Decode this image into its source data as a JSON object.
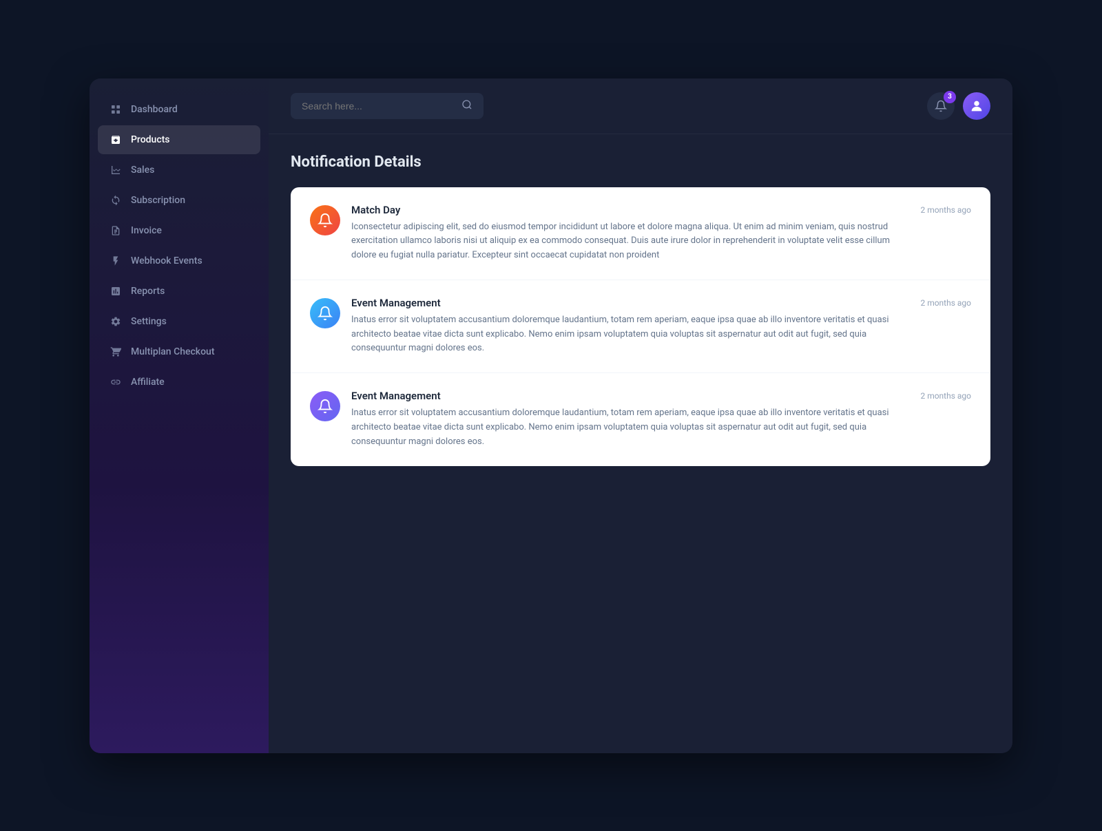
{
  "sidebar": {
    "nav_items": [
      {
        "id": "dashboard",
        "label": "Dashboard",
        "icon": "⊞",
        "active": false
      },
      {
        "id": "products",
        "label": "Products",
        "icon": "🏷",
        "active": true
      },
      {
        "id": "sales",
        "label": "Sales",
        "icon": "📊",
        "active": false
      },
      {
        "id": "subscription",
        "label": "Subscription",
        "icon": "🔄",
        "active": false
      },
      {
        "id": "invoice",
        "label": "Invoice",
        "icon": "📄",
        "active": false
      },
      {
        "id": "webhook-events",
        "label": "Webhook Events",
        "icon": "⚡",
        "active": false
      },
      {
        "id": "reports",
        "label": "Reports",
        "icon": "📈",
        "active": false
      },
      {
        "id": "settings",
        "label": "Settings",
        "icon": "⚙️",
        "active": false
      },
      {
        "id": "multiplan-checkout",
        "label": "Multiplan Checkout",
        "icon": "🛒",
        "active": false
      },
      {
        "id": "affiliate",
        "label": "Affiliate",
        "icon": "🔗",
        "active": false
      }
    ]
  },
  "header": {
    "search_placeholder": "Search here...",
    "notification_count": "3"
  },
  "page": {
    "title": "Notification Details"
  },
  "notifications": [
    {
      "id": 1,
      "icon_type": "orange",
      "title": "Match Day",
      "text": "Iconsectetur adipiscing elit, sed do eiusmod tempor incididunt ut labore et dolore magna aliqua. Ut enim ad minim veniam, quis nostrud exercitation ullamco laboris nisi ut aliquip ex ea commodo consequat. Duis aute irure dolor in reprehenderit in voluptate velit esse cillum dolore eu fugiat nulla pariatur. Excepteur sint occaecat cupidatat non proident",
      "time": "2 months ago"
    },
    {
      "id": 2,
      "icon_type": "blue",
      "title": "Event Management",
      "text": "Inatus error sit voluptatem accusantium doloremque laudantium, totam rem aperiam, eaque ipsa quae ab illo inventore veritatis et quasi architecto beatae vitae dicta sunt explicabo. Nemo enim ipsam voluptatem quia voluptas sit aspernatur aut odit aut fugit, sed quia consequuntur magni dolores eos.",
      "time": "2 months ago"
    },
    {
      "id": 3,
      "icon_type": "purple",
      "title": "Event Management",
      "text": "Inatus error sit voluptatem accusantium doloremque laudantium, totam rem aperiam, eaque ipsa quae ab illo inventore veritatis et quasi architecto beatae vitae dicta sunt explicabo. Nemo enim ipsam voluptatem quia voluptas sit aspernatur aut odit aut fugit, sed quia consequuntur magni dolores eos.",
      "time": "2 months ago"
    }
  ]
}
